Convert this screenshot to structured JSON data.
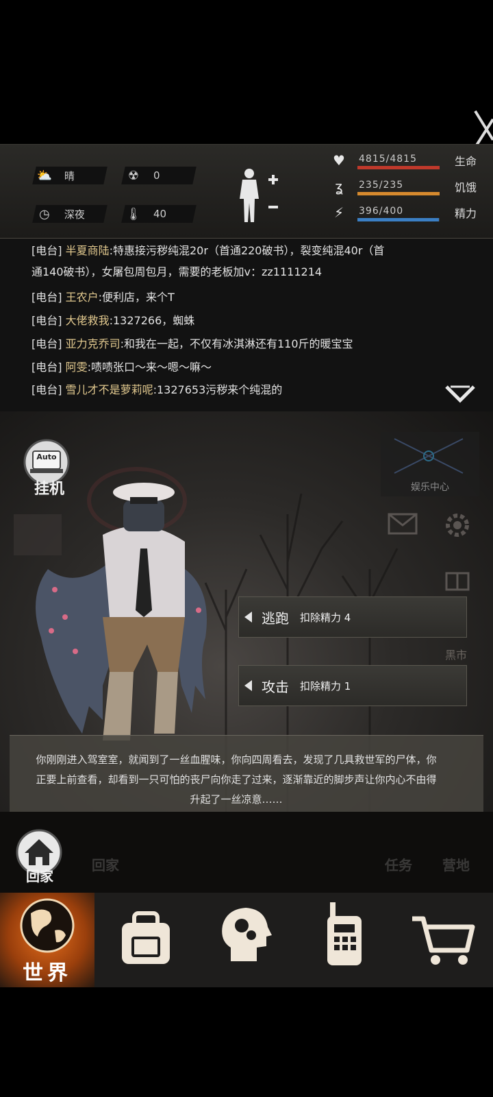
{
  "status": {
    "weather": {
      "icon": "cloud-sun-icon",
      "text": "晴"
    },
    "radiation": {
      "icon": "radiation-icon",
      "text": "0"
    },
    "time": {
      "icon": "clock-icon",
      "text": "深夜"
    },
    "temperature": {
      "icon": "thermometer-icon",
      "text": "40"
    },
    "stats": [
      {
        "label": "生命",
        "value": "4815/4815",
        "fraction": 1.0,
        "color": "#c0392b",
        "icon": "heart-icon"
      },
      {
        "label": "饥饿",
        "value": "235/235",
        "fraction": 1.0,
        "color": "#d68a2e",
        "icon": "stomach-icon"
      },
      {
        "label": "精力",
        "value": "396/400",
        "fraction": 0.99,
        "color": "#3b7fc4",
        "icon": "energy-head-icon"
      }
    ]
  },
  "chat": [
    {
      "tag": "[电台]",
      "name": "半夏商陆",
      "msg": ":特惠接污秽纯混20r（首通220破书），裂变纯混40r（首"
    },
    {
      "tag": "",
      "name": "",
      "msg": "通140破书），女屠包周包月，需要的老板加v：zz1111214"
    },
    {
      "tag": "[电台]",
      "name": "王农户",
      "msg": ":便利店，来个T"
    },
    {
      "tag": "[电台]",
      "name": "大佬救我",
      "msg": ":1327266，蜘蛛"
    },
    {
      "tag": "[电台]",
      "name": "亚力克乔司",
      "msg": ":和我在一起，不仅有冰淇淋还有110斤的暖宝宝"
    },
    {
      "tag": "[电台]",
      "name": "阿雯",
      "msg": ":啧啧张口～来～嗯～嘛～"
    },
    {
      "tag": "[电台]",
      "name": "雪儿才不是萝莉呢",
      "msg": ":1327653污秽来个纯混的"
    }
  ],
  "scene": {
    "auto": {
      "badge": "Auto",
      "label": "挂机"
    },
    "entertainment": "娱乐中心",
    "black_market": "黑市",
    "actions": [
      {
        "name": "逃跑",
        "cost": "扣除精力 4"
      },
      {
        "name": "攻击",
        "cost": "扣除精力 1"
      }
    ],
    "story": "你刚刚进入驾室室，就闻到了一丝血腥味，你向四周看去，发现了几具救世军的尸体，你正要上前查看，却看到一只可怕的丧尸向你走了过来，逐渐靠近的脚步声让你内心不由得升起了一丝凉意……",
    "home": "回家",
    "ghost_home": "回家",
    "ghost_task": "任务",
    "ghost_camp": "营地"
  },
  "tabs": [
    {
      "label": "世界",
      "icon": "globe-icon",
      "active": true
    },
    {
      "label": "",
      "icon": "backpack-icon",
      "active": false
    },
    {
      "label": "",
      "icon": "head-gears-icon",
      "active": false
    },
    {
      "label": "",
      "icon": "walkie-talkie-icon",
      "active": false
    },
    {
      "label": "",
      "icon": "shopping-cart-icon",
      "active": false
    }
  ]
}
